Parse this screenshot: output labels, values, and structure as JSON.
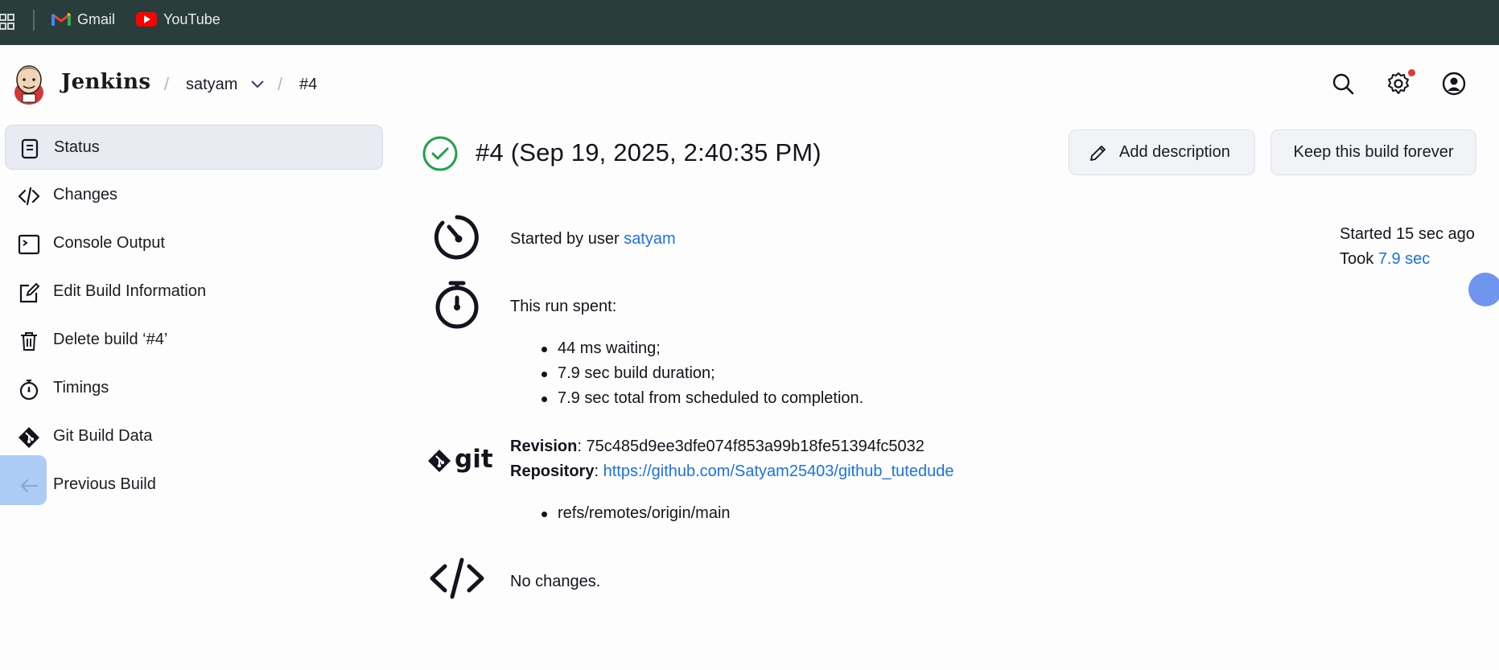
{
  "bookmarks": {
    "items": [
      {
        "label": "Gmail",
        "icon": "gmail-icon"
      },
      {
        "label": "YouTube",
        "icon": "youtube-icon"
      }
    ]
  },
  "header": {
    "brand": "Jenkins",
    "breadcrumbs": [
      "satyam",
      "#4"
    ],
    "separator": "/"
  },
  "sidebar": {
    "items": [
      {
        "label": "Status",
        "icon": "status-icon",
        "active": true
      },
      {
        "label": "Changes",
        "icon": "code-icon"
      },
      {
        "label": "Console Output",
        "icon": "terminal-icon"
      },
      {
        "label": "Edit Build Information",
        "icon": "edit-icon"
      },
      {
        "label": "Delete build ‘#4’",
        "icon": "trash-icon"
      },
      {
        "label": "Timings",
        "icon": "stopwatch-icon"
      },
      {
        "label": "Git Build Data",
        "icon": "git-icon"
      },
      {
        "label": "Previous Build",
        "icon": "arrow-left-icon"
      }
    ]
  },
  "build": {
    "title": "#4 (Sep 19, 2025, 2:40:35 PM)",
    "status": "success",
    "add_description_label": "Add description",
    "keep_forever_label": "Keep this build forever",
    "started_prefix": "Started by user ",
    "started_user": "satyam",
    "started_ago": "Started 15 sec ago",
    "took_prefix": "Took ",
    "took_value": "7.9 sec",
    "run_spent_label": "This run spent:",
    "run_spent_items": [
      "44 ms waiting;",
      "7.9 sec build duration;",
      "7.9 sec total from scheduled to completion."
    ],
    "git_logo_text": "git",
    "revision_label": "Revision",
    "revision_value": "75c485d9ee3dfe074f853a99b18fe51394fc5032",
    "repository_label": "Repository",
    "repository_url": "https://github.com/Satyam25403/github_tutedude",
    "refs": [
      "refs/remotes/origin/main"
    ],
    "changes_text": "No changes."
  },
  "colors": {
    "bookmark_bar": "#293d3a",
    "success": "#1ea446",
    "link": "#1a73e8",
    "active_bg": "#e8ebf2",
    "notification": "#e63535"
  }
}
